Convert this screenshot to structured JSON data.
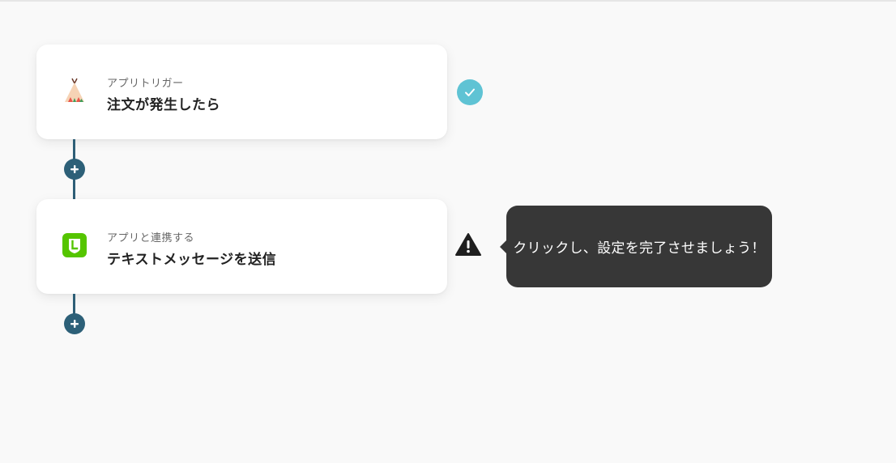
{
  "flow": {
    "steps": [
      {
        "type_label": "アプリトリガー",
        "title": "注文が発生したら",
        "icon": "teepee-icon",
        "status": "completed"
      },
      {
        "type_label": "アプリと連携する",
        "title": "テキストメッセージを送信",
        "icon": "line-app-icon",
        "status": "incomplete"
      }
    ],
    "tooltip": "クリックし、設定を完了させましょう！"
  },
  "colors": {
    "background": "#f9f9f9",
    "connector": "#2d6078",
    "check": "#5fc3d4",
    "line_green": "#55c500",
    "tooltip_bg": "#373737"
  }
}
